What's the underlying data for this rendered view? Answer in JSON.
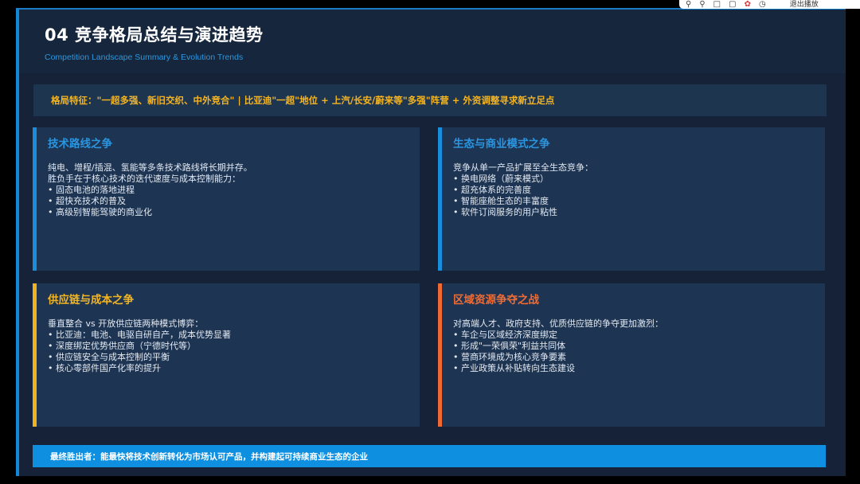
{
  "header": {
    "title": "04  竞争格局总结与演进趋势",
    "subtitle": "Competition Landscape Summary & Evolution Trends"
  },
  "banner": {
    "text": "格局特征：\"一超多强、新旧交织、中外竞合\"  |  比亚迪\"一超\"地位 + 上汽/长安/蔚来等\"多强\"阵营 + 外资调整寻求新立足点"
  },
  "cards": [
    {
      "title": "技术路线之争",
      "lines": [
        "纯电、增程/插混、氢能等多条技术路线将长期并存。",
        "胜负手在于核心技术的迭代速度与成本控制能力："
      ],
      "bullets": [
        "固态电池的落地进程",
        "超快充技术的普及",
        "高级别智能驾驶的商业化"
      ],
      "accent": "#1a8ddc"
    },
    {
      "title": "生态与商业模式之争",
      "lines": [
        "竞争从单一产品扩展至全生态竞争："
      ],
      "bullets": [
        "换电网络（蔚来模式）",
        "超充体系的完善度",
        "智能座舱生态的丰富度",
        "软件订阅服务的用户粘性"
      ],
      "accent": "#1a8ddc"
    },
    {
      "title": "供应链与成本之争",
      "lines": [
        "垂直整合 vs 开放供应链两种模式博弈："
      ],
      "bullets": [
        "比亚迪：电池、电驱自研自产，成本优势显著",
        "深度绑定优势供应商（宁德时代等）",
        "供应链安全与成本控制的平衡",
        "核心零部件国产化率的提升"
      ],
      "accent": "#f0b31f"
    },
    {
      "title": "区域资源争夺之战",
      "lines": [
        "对高端人才、政府支持、优质供应链的争夺更加激烈："
      ],
      "bullets": [
        "车企与区域经济深度绑定",
        "形成\"一荣俱荣\"利益共同体",
        "营商环境成为核心竞争要素",
        "产业政策从补贴转向生态建设"
      ],
      "accent": "#ef6a33"
    }
  ],
  "footer": {
    "text": "最终胜出者：能最快将技术创新转化为市场认可产品，并构建起可持续商业生态的企业"
  },
  "toolbar": {
    "icons": [
      "search-icon",
      "zoom-icon",
      "copy-icon",
      "share-icon",
      "sign-icon",
      "history-icon"
    ],
    "exit_label": "退出播放"
  }
}
